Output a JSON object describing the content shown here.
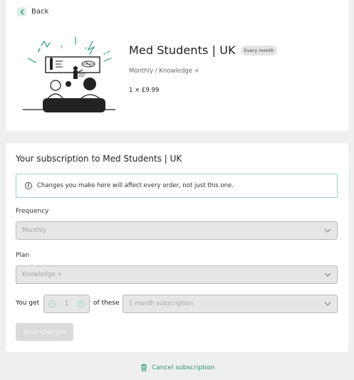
{
  "header": {
    "back_label": "Back"
  },
  "product": {
    "title": "Med Students | UK",
    "badge": "Every month",
    "subline": "Monthly / Knowledge +",
    "price": "1 × £9.99"
  },
  "subscription": {
    "section_title": "Your subscription to Med Students | UK",
    "notice": "Changes you make here will affect every order, not just this one.",
    "frequency_label": "Frequency",
    "frequency_value": "Monthly",
    "plan_label": "Plan",
    "plan_value": "Knowledge +",
    "you_get_label": "You get",
    "quantity": "1",
    "of_these_label": "of these",
    "period_value": "1 month subscription",
    "save_label": "Save changes"
  },
  "footer": {
    "cancel_label": "Cancel subscription"
  },
  "colors": {
    "accent": "#2f8f78",
    "accent_light": "#9fd2c5",
    "background": "#eef0ef"
  },
  "icons": [
    "chevron-left-icon",
    "info-icon",
    "chevron-down-icon",
    "minus-circle-icon",
    "plus-circle-icon",
    "trash-icon"
  ]
}
